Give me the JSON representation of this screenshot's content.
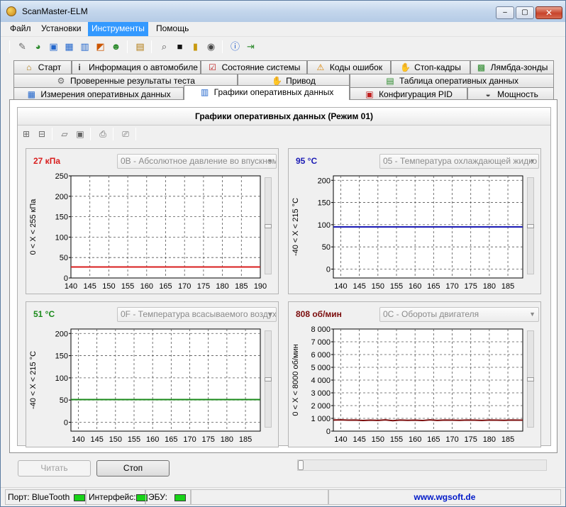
{
  "window": {
    "title": "ScanMaster-ELM",
    "buttons": {
      "minimize": "–",
      "maximize": "▢",
      "close": "✕"
    }
  },
  "menu": [
    {
      "label": "Файл"
    },
    {
      "label": "Установки"
    },
    {
      "label": "Инструменты",
      "active": true
    },
    {
      "label": "Помощь"
    }
  ],
  "toolbar_icons": [
    "wrench-icon",
    "globe-icon",
    "connect-icon",
    "grid-icon",
    "chart-icon",
    "flag-icon",
    "person-icon",
    "clipboard-icon",
    "search-icon",
    "terminal-icon",
    "battery-icon",
    "dial-icon",
    "info-icon",
    "exit-icon"
  ],
  "tabs": {
    "row1": [
      {
        "label": "Старт",
        "icon": "home-icon"
      },
      {
        "label": "Информация о автомобиле",
        "icon": "info-icon"
      },
      {
        "label": "Состояние системы",
        "icon": "checkbox-icon"
      },
      {
        "label": "Коды ошибок",
        "icon": "warning-icon"
      },
      {
        "label": "Стоп-кадры",
        "icon": "hand-icon"
      },
      {
        "label": "Лямбда-зонды",
        "icon": "sensor-icon"
      }
    ],
    "row2": [
      {
        "label": "Проверенные результаты теста",
        "icon": "gear-icon"
      },
      {
        "label": "Привод",
        "icon": "hand-icon"
      },
      {
        "label": "Таблица оперативных данных",
        "icon": "table-icon"
      }
    ],
    "row3": [
      {
        "label": "Измерения оперативных данных",
        "icon": "grid-icon"
      },
      {
        "label": "Графики оперативных данных",
        "icon": "chart-icon",
        "selected": true
      },
      {
        "label": "Конфигурация PID",
        "icon": "config-icon"
      },
      {
        "label": "Мощность",
        "icon": "gauge-icon"
      }
    ]
  },
  "content": {
    "header": "Графики оперативных данных (Режим 01)"
  },
  "graph_toolbar": [
    "add-graph-icon",
    "remove-graph-icon",
    "open-icon",
    "save-icon",
    "print-icon",
    "print-preview-icon"
  ],
  "colors": {
    "red": "#d81e1e",
    "blue": "#1a1ab4",
    "green": "#1a8a1a",
    "maroon": "#7a0b0b"
  },
  "chart_data": [
    {
      "type": "line",
      "value_label": "27 кПа",
      "value_color": "#d81e1e",
      "pid_select": "0B - Абсолютное давление во впускном",
      "ylabel": "0 < X < 255 кПа",
      "xlim": [
        140,
        190
      ],
      "ylim": [
        0,
        250
      ],
      "xticks": [
        "140",
        "145",
        "150",
        "155",
        "160",
        "165",
        "170",
        "175",
        "180",
        "185",
        "190"
      ],
      "yticks": [
        "0",
        "50",
        "100",
        "150",
        "200",
        "250"
      ],
      "series": [
        {
          "color": "#d81e1e",
          "x": [
            140,
            190
          ],
          "y": [
            27,
            27
          ]
        }
      ]
    },
    {
      "type": "line",
      "value_label": "95 °C",
      "value_color": "#1a1ab4",
      "pid_select": "05 - Температура охлаждающей жидко",
      "ylabel": "-40 < X < 215 °C",
      "xlim": [
        138,
        189
      ],
      "ylim": [
        -20,
        210
      ],
      "xticks": [
        "140",
        "145",
        "150",
        "155",
        "160",
        "165",
        "170",
        "175",
        "180",
        "185"
      ],
      "yticks": [
        "0",
        "50",
        "100",
        "150",
        "200"
      ],
      "series": [
        {
          "color": "#1a1ab4",
          "x": [
            138,
            189
          ],
          "y": [
            95,
            95
          ]
        }
      ]
    },
    {
      "type": "line",
      "value_label": "51 °C",
      "value_color": "#1a8a1a",
      "pid_select": "0F - Температура всасываемого воздух",
      "ylabel": "-40 < X < 215 °C",
      "xlim": [
        138,
        189
      ],
      "ylim": [
        -20,
        210
      ],
      "xticks": [
        "140",
        "145",
        "150",
        "155",
        "160",
        "165",
        "170",
        "175",
        "180",
        "185"
      ],
      "yticks": [
        "0",
        "50",
        "100",
        "150",
        "200"
      ],
      "series": [
        {
          "color": "#1a8a1a",
          "x": [
            138,
            189
          ],
          "y": [
            51,
            51
          ]
        }
      ]
    },
    {
      "type": "line",
      "value_label": "808 об/мин",
      "value_color": "#7a0b0b",
      "pid_select": "0C - Обороты двигателя",
      "ylabel": "0 < X < 8000 об/мин",
      "xlim": [
        138,
        189
      ],
      "ylim": [
        0,
        8000
      ],
      "xticks": [
        "140",
        "145",
        "150",
        "155",
        "160",
        "165",
        "170",
        "175",
        "180",
        "185"
      ],
      "yticks": [
        "0",
        "1 000",
        "2 000",
        "3 000",
        "4 000",
        "5 000",
        "6 000",
        "7 000",
        "8 000"
      ],
      "series": [
        {
          "color": "#7a0b0b",
          "x": [
            138,
            140,
            142,
            144,
            146,
            148,
            150,
            152,
            154,
            156,
            158,
            160,
            162,
            164,
            166,
            168,
            170,
            172,
            174,
            176,
            178,
            180,
            182,
            184,
            186,
            188,
            189
          ],
          "y": [
            870,
            880,
            860,
            870,
            830,
            860,
            840,
            880,
            820,
            870,
            850,
            860,
            830,
            880,
            840,
            870,
            860,
            850,
            870,
            860,
            840,
            870,
            860,
            850,
            870,
            860,
            860
          ]
        }
      ]
    }
  ],
  "buttons": {
    "read": "Читать",
    "stop": "Стоп"
  },
  "status": {
    "port": "Порт: BlueTooth",
    "interface": "Интерфейс:",
    "ecu": "ЭБУ:",
    "link": "www.wgsoft.de"
  }
}
